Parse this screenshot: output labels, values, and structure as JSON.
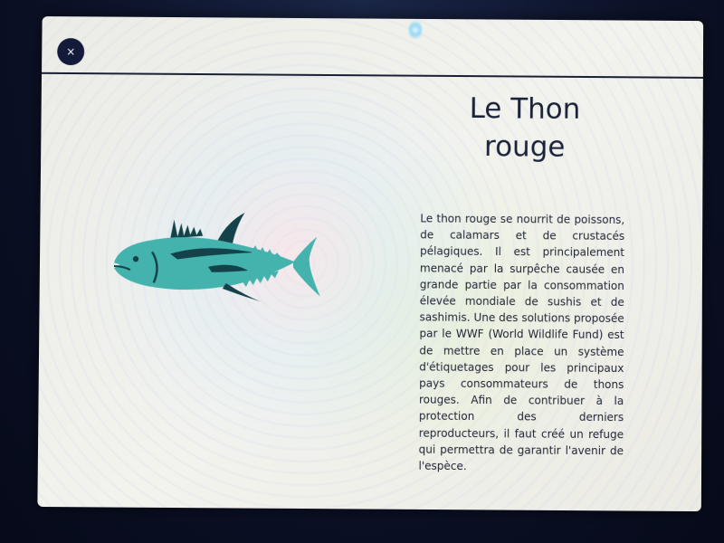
{
  "close": {
    "glyph": "×"
  },
  "article": {
    "title_line1": "Le Thon",
    "title_line2": "rouge",
    "body": "Le thon rouge se nourrit de poissons, de calamars et de crustacés pélagiques. Il est principalement menacé par la surpêche causée en grande partie par la consommation élevée mondiale de sushis et de sashimis. Une des solutions proposée par le WWF (World Wildlife Fund) est de mettre en place un système d'étiquetages pour les principaux pays consommateurs de thons rouges. Afin de contribuer à la protection des derniers reproducteurs, il faut créé un refuge qui permettra de garantir l'avenir de l'espèce."
  },
  "illustration": {
    "icon": "tuna-fish-icon",
    "body_color": "#45b3ad",
    "dark_color": "#14424a"
  },
  "colors": {
    "close_button_bg": "#131a3a",
    "title_color": "#1b2338",
    "divider": "#1a2033"
  }
}
